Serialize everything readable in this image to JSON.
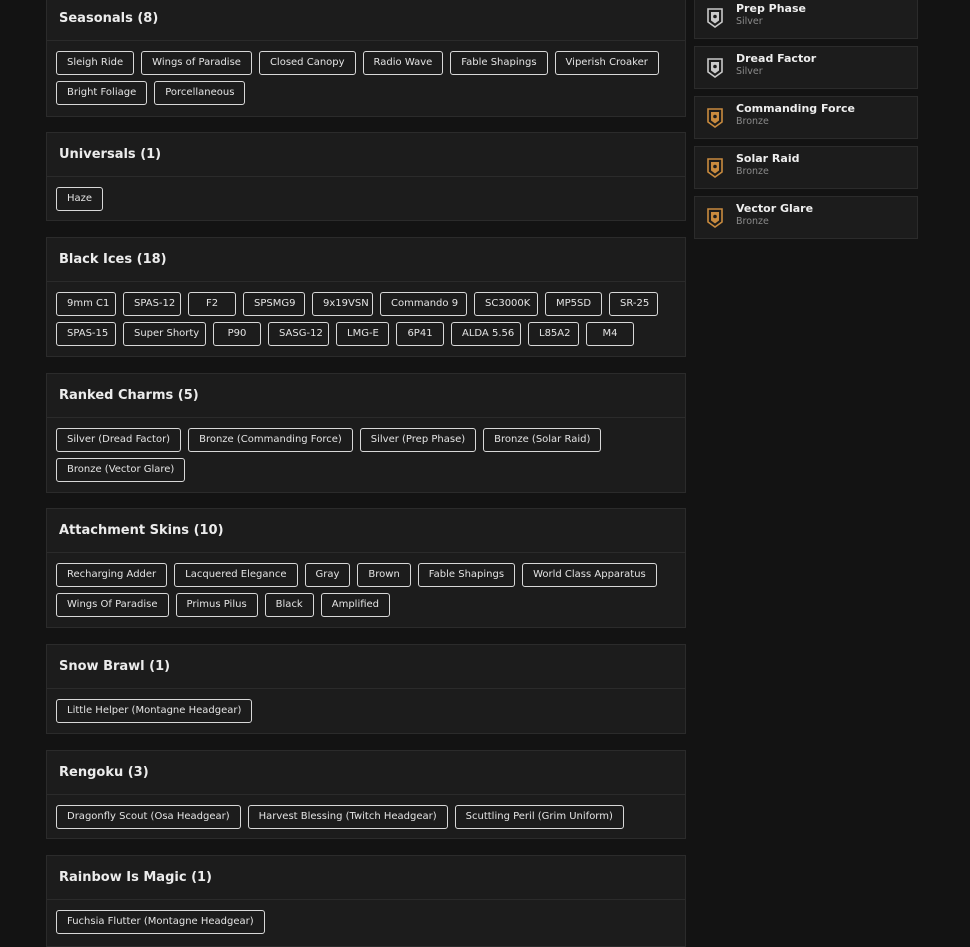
{
  "sections": [
    {
      "title": "Seasonals (8)",
      "tags": [
        "Sleigh Ride",
        "Wings of Paradise",
        "Closed Canopy",
        "Radio Wave",
        "Fable Shapings",
        "Viperish Croaker",
        "Bright Foliage",
        "Porcellaneous"
      ]
    },
    {
      "title": "Universals (1)",
      "tags": [
        "Haze"
      ]
    },
    {
      "title": "Black Ices (18)",
      "tags": [
        "9mm C1",
        "SPAS-12",
        "F2",
        "SPSMG9",
        "9x19VSN",
        "Commando 9",
        "SC3000K",
        "MP5SD",
        "SR-25",
        "SPAS-15",
        "Super Shorty",
        "P90",
        "SASG-12",
        "LMG-E",
        "6P41",
        "ALDA 5.56",
        "L85A2",
        "M4"
      ]
    },
    {
      "title": "Ranked Charms (5)",
      "tags": [
        "Silver (Dread Factor)",
        "Bronze (Commanding Force)",
        "Silver (Prep Phase)",
        "Bronze (Solar Raid)",
        "Bronze (Vector Glare)"
      ]
    },
    {
      "title": "Attachment Skins (10)",
      "tags": [
        "Recharging Adder",
        "Lacquered Elegance",
        "Gray",
        "Brown",
        "Fable Shapings",
        "World Class Apparatus",
        "Wings Of Paradise",
        "Primus Pilus",
        "Black",
        "Amplified"
      ]
    },
    {
      "title": "Snow Brawl (1)",
      "tags": [
        "Little Helper (Montagne Headgear)"
      ]
    },
    {
      "title": "Rengoku (3)",
      "tags": [
        "Dragonfly Scout (Osa Headgear)",
        "Harvest Blessing (Twitch Headgear)",
        "Scuttling Peril (Grim Uniform)"
      ]
    },
    {
      "title": "Rainbow Is Magic (1)",
      "tags": [
        "Fuchsia Flutter (Montagne Headgear)"
      ]
    }
  ],
  "charms": [
    {
      "name": "Prep Phase",
      "tier": "Silver",
      "icon": "silver-charm-icon",
      "color": "#c9c9c9"
    },
    {
      "name": "Dread Factor",
      "tier": "Silver",
      "icon": "silver-charm-icon",
      "color": "#c9c9c9"
    },
    {
      "name": "Commanding Force",
      "tier": "Bronze",
      "icon": "bronze-charm-icon",
      "color": "#c88a3e"
    },
    {
      "name": "Solar Raid",
      "tier": "Bronze",
      "icon": "bronze-charm-icon",
      "color": "#c88a3e"
    },
    {
      "name": "Vector Glare",
      "tier": "Bronze",
      "icon": "bronze-charm-icon",
      "color": "#c88a3e"
    }
  ]
}
